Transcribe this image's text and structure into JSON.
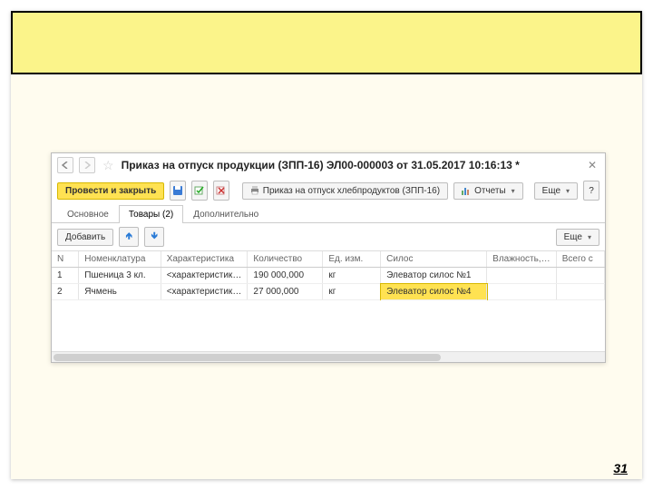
{
  "titlebar": {
    "title": "Приказ на отпуск продукции (ЗПП-16) ЭЛ00-000003 от 31.05.2017 10:16:13 *"
  },
  "toolbar": {
    "post_close": "Провести и закрыть",
    "print_label": "Приказ на отпуск хлебпродуктов (ЗПП-16)",
    "reports": "Отчеты",
    "more": "Еще",
    "help": "?"
  },
  "tabs": {
    "main": "Основное",
    "goods": "Товары (2)",
    "extra": "Дополнительно"
  },
  "subbar": {
    "add": "Добавить",
    "more": "Еще"
  },
  "columns": {
    "n": "N",
    "nomenclature": "Номенклатура",
    "characteristic": "Характеристика",
    "quantity": "Количество",
    "uom": "Ед. изм.",
    "silo": "Силос",
    "humidity": "Влажность, %",
    "total": "Всего с"
  },
  "rows": [
    {
      "n": "1",
      "nomenclature": "Пшеница 3 кл.",
      "characteristic": "<характеристик н...",
      "quantity": "190 000,000",
      "uom": "кг",
      "silo": "Элеватор силос №1",
      "humidity": "",
      "total": ""
    },
    {
      "n": "2",
      "nomenclature": "Ячмень",
      "characteristic": "<характеристик н...",
      "quantity": "27 000,000",
      "uom": "кг",
      "silo": "Элеватор силос №4",
      "humidity": "",
      "total": ""
    }
  ],
  "page_number": "31"
}
